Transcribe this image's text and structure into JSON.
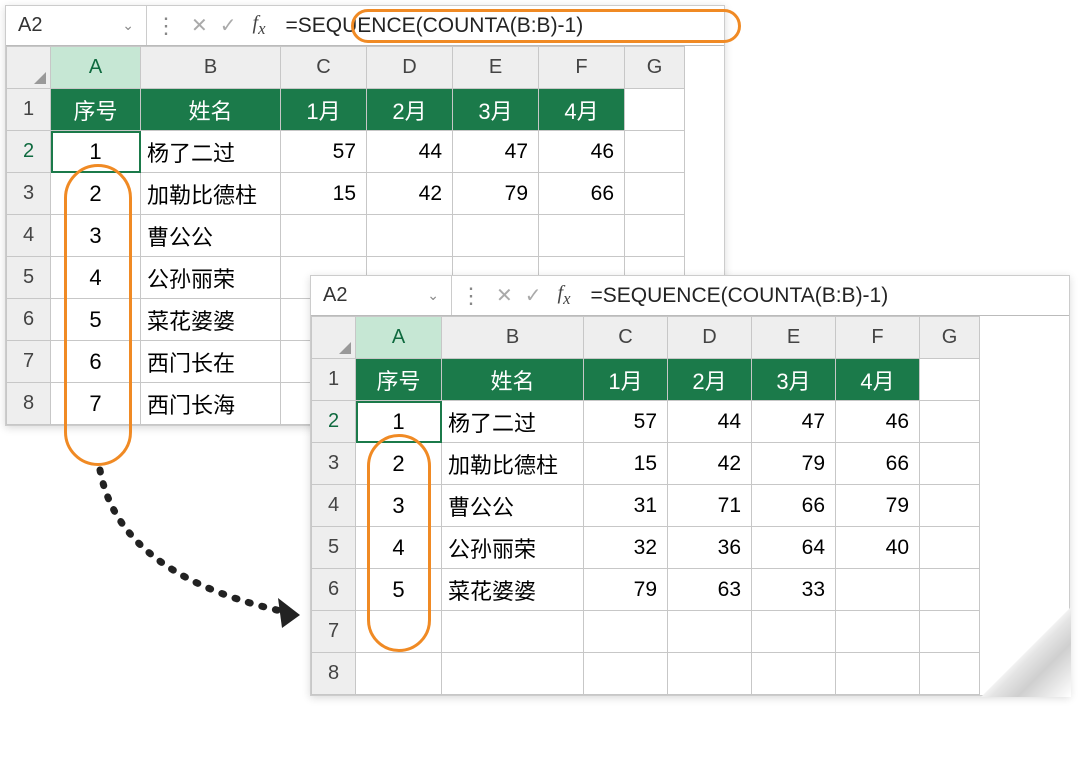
{
  "wb1": {
    "cellRef": "A2",
    "formula": "=SEQUENCE(COUNTA(B:B)-1)",
    "cols": [
      "A",
      "B",
      "C",
      "D",
      "E",
      "F",
      "G"
    ],
    "rows": [
      "1",
      "2",
      "3",
      "4",
      "5",
      "6",
      "7",
      "8"
    ],
    "headers": {
      "A": "序号",
      "B": "姓名",
      "C": "1月",
      "D": "2月",
      "E": "3月",
      "F": "4月"
    },
    "data": [
      {
        "seq": "1",
        "name": "杨了二过",
        "c": "57",
        "d": "44",
        "e": "47",
        "f": "46"
      },
      {
        "seq": "2",
        "name": "加勒比德柱",
        "c": "15",
        "d": "42",
        "e": "79",
        "f": "66"
      },
      {
        "seq": "3",
        "name": "曹公公",
        "c": "",
        "d": "",
        "e": "",
        "f": ""
      },
      {
        "seq": "4",
        "name": "公孙丽荣",
        "c": "",
        "d": "",
        "e": "",
        "f": ""
      },
      {
        "seq": "5",
        "name": "菜花婆婆",
        "c": "",
        "d": "",
        "e": "",
        "f": ""
      },
      {
        "seq": "6",
        "name": "西门长在",
        "c": "",
        "d": "",
        "e": "",
        "f": ""
      },
      {
        "seq": "7",
        "name": "西门长海",
        "c": "",
        "d": "",
        "e": "",
        "f": ""
      }
    ]
  },
  "wb2": {
    "cellRef": "A2",
    "formula": "=SEQUENCE(COUNTA(B:B)-1)",
    "cols": [
      "A",
      "B",
      "C",
      "D",
      "E",
      "F",
      "G"
    ],
    "rows": [
      "1",
      "2",
      "3",
      "4",
      "5",
      "6",
      "7",
      "8"
    ],
    "headers": {
      "A": "序号",
      "B": "姓名",
      "C": "1月",
      "D": "2月",
      "E": "3月",
      "F": "4月"
    },
    "data": [
      {
        "seq": "1",
        "name": "杨了二过",
        "c": "57",
        "d": "44",
        "e": "47",
        "f": "46"
      },
      {
        "seq": "2",
        "name": "加勒比德柱",
        "c": "15",
        "d": "42",
        "e": "79",
        "f": "66"
      },
      {
        "seq": "3",
        "name": "曹公公",
        "c": "31",
        "d": "71",
        "e": "66",
        "f": "79"
      },
      {
        "seq": "4",
        "name": "公孙丽荣",
        "c": "32",
        "d": "36",
        "e": "64",
        "f": "40"
      },
      {
        "seq": "5",
        "name": "菜花婆婆",
        "c": "79",
        "d": "63",
        "e": "33",
        "f": ""
      }
    ]
  }
}
